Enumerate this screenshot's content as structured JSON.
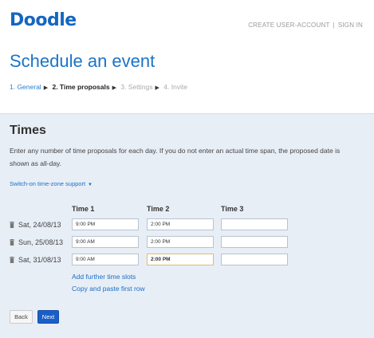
{
  "header": {
    "logo": "Doodle",
    "create_account": "CREATE USER-ACCOUNT",
    "separator": "|",
    "sign_in": "SIGN IN"
  },
  "page_title": "Schedule an event",
  "steps": [
    {
      "label": "1. General",
      "state": "done"
    },
    {
      "label": "2. Time proposals",
      "state": "current"
    },
    {
      "label": "3. Settings",
      "state": "future"
    },
    {
      "label": "4. Invite",
      "state": "future"
    }
  ],
  "times": {
    "title": "Times",
    "description": "Enter any number of time proposals for each day. If you do not enter an actual time span, the proposed date is shown as all-day.",
    "timezone_link": "Switch-on time-zone support",
    "columns": [
      "Time 1",
      "Time 2",
      "Time 3"
    ],
    "rows": [
      {
        "date": "Sat, 24/08/13",
        "times": [
          "9:00 PM",
          "2:00 PM",
          ""
        ]
      },
      {
        "date": "Sun, 25/08/13",
        "times": [
          "9:00 AM",
          "2:00 PM",
          ""
        ]
      },
      {
        "date": "Sat, 31/08/13",
        "times": [
          "9:00 AM",
          "2:00 PM",
          ""
        ]
      }
    ],
    "add_slots": "Add further time slots",
    "copy_first_row": "Copy and paste first row"
  },
  "buttons": {
    "back": "Back",
    "next": "Next"
  },
  "colors": {
    "brand": "#1566c0",
    "panel_bg": "#e8eef6",
    "link": "#1a6fc8",
    "next_button": "#1a5fc8",
    "focus_border": "#e7b86a"
  }
}
